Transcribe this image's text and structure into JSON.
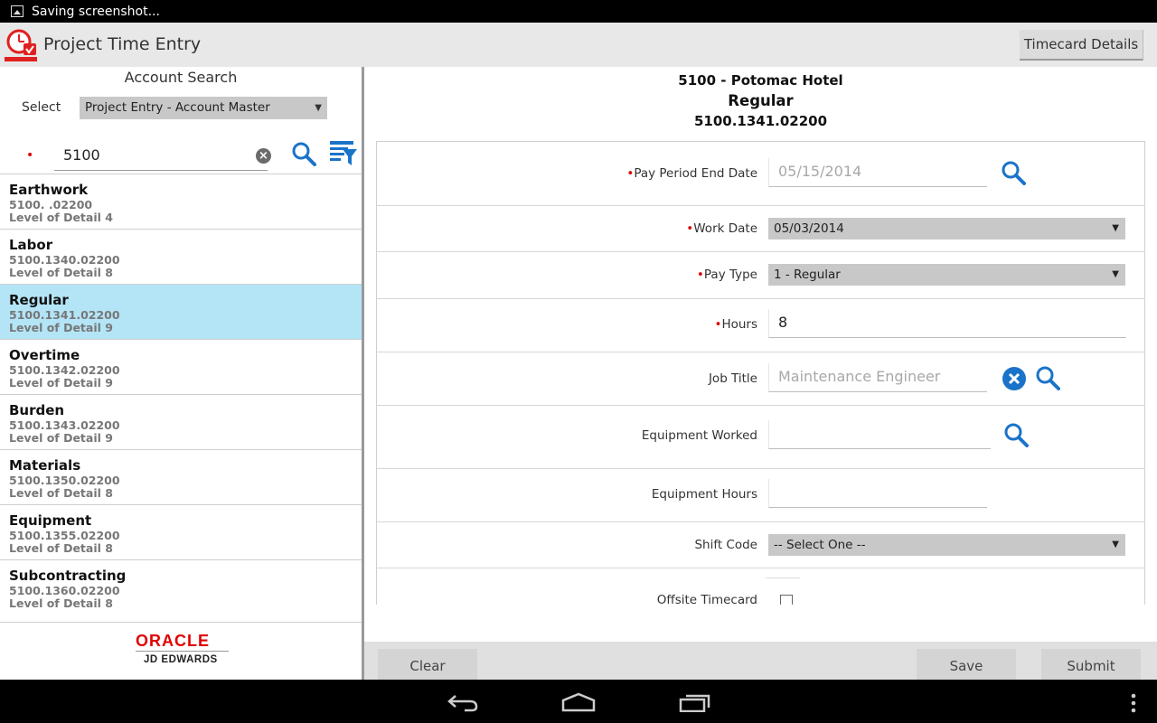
{
  "status_bar": {
    "notification": "Saving screenshot..."
  },
  "app": {
    "title": "Project Time Entry",
    "timecard_details_button": "Timecard Details"
  },
  "account_search": {
    "title": "Account Search",
    "select_label": "Select",
    "select_value": "Project Entry - Account Master",
    "search_value": "5100",
    "items": [
      {
        "name": "Earthwork",
        "code": "5100. .02200",
        "level": "Level of Detail 4",
        "selected": false
      },
      {
        "name": "Labor",
        "code": "5100.1340.02200",
        "level": "Level of Detail 8",
        "selected": false
      },
      {
        "name": "Regular",
        "code": "5100.1341.02200",
        "level": "Level of Detail 9",
        "selected": true
      },
      {
        "name": "Overtime",
        "code": "5100.1342.02200",
        "level": "Level of Detail 9",
        "selected": false
      },
      {
        "name": "Burden",
        "code": "5100.1343.02200",
        "level": "Level of Detail 9",
        "selected": false
      },
      {
        "name": "Materials",
        "code": "5100.1350.02200",
        "level": "Level of Detail 8",
        "selected": false
      },
      {
        "name": "Equipment",
        "code": "5100.1355.02200",
        "level": "Level of Detail 8",
        "selected": false
      },
      {
        "name": "Subcontracting",
        "code": "5100.1360.02200",
        "level": "Level of Detail 8",
        "selected": false
      }
    ]
  },
  "branding": {
    "oracle": "ORACLE",
    "jde": "JD EDWARDS"
  },
  "header": {
    "project": "5100 - Potomac Hotel",
    "account": "Regular",
    "account_code": "5100.1341.02200"
  },
  "form": {
    "pay_period_end_date": {
      "label": "Pay Period End Date",
      "value": "05/15/2014"
    },
    "work_date": {
      "label": "Work Date",
      "value": "05/03/2014"
    },
    "pay_type": {
      "label": "Pay Type",
      "value": "1 - Regular"
    },
    "hours": {
      "label": "Hours",
      "value": "8"
    },
    "job_title": {
      "label": "Job Title",
      "value": "Maintenance Engineer"
    },
    "equipment_worked": {
      "label": "Equipment Worked",
      "value": ""
    },
    "equipment_hours": {
      "label": "Equipment Hours",
      "value": ""
    },
    "shift_code": {
      "label": "Shift Code",
      "value": "-- Select One --"
    },
    "offsite_timecard": {
      "label": "Offsite Timecard",
      "checked": false
    }
  },
  "actions": {
    "clear": "Clear",
    "save": "Save",
    "submit": "Submit"
  },
  "colors": {
    "accent_blue": "#1a73c9",
    "selected_row": "#b3e5f7",
    "required": "#dd0000",
    "oracle_red": "#e00000"
  },
  "icons": [
    "image-icon",
    "app-clock-icon",
    "search-icon",
    "filter-list-icon",
    "clear-icon",
    "back-icon",
    "home-icon",
    "recents-icon",
    "overflow-menu-icon"
  ]
}
